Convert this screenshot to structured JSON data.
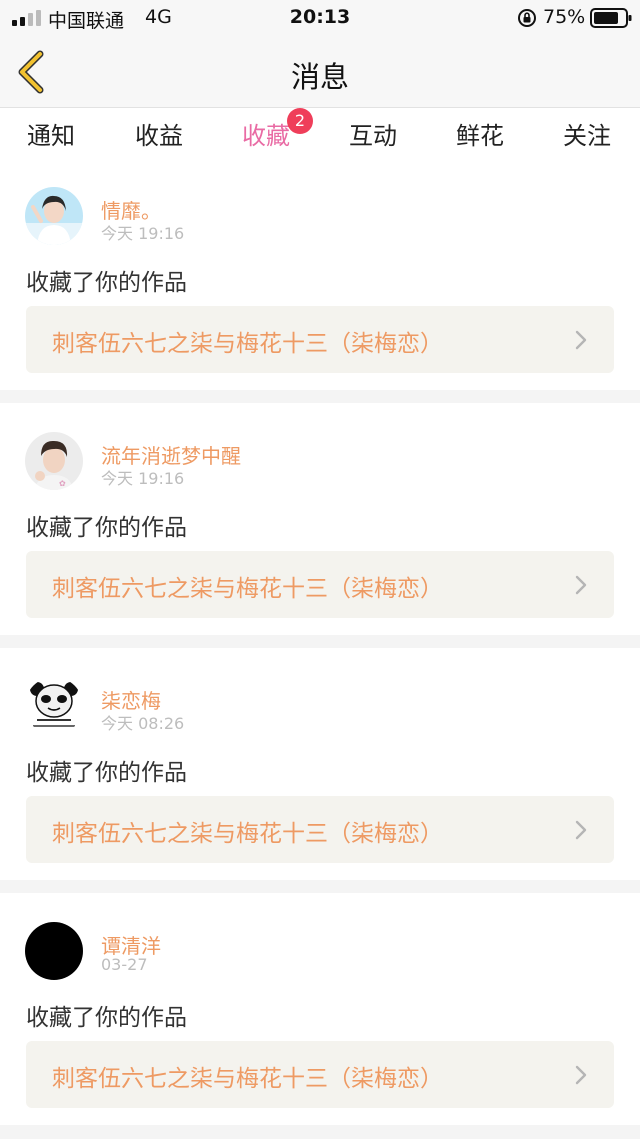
{
  "status": {
    "carrier": "中国联通",
    "network": "4G",
    "time": "20:13",
    "battery": "75%"
  },
  "nav": {
    "title": "消息"
  },
  "tabs": [
    {
      "label": "通知"
    },
    {
      "label": "收益"
    },
    {
      "label": "收藏",
      "badge": "2"
    },
    {
      "label": "互动"
    },
    {
      "label": "鲜花"
    },
    {
      "label": "关注"
    }
  ],
  "messages": [
    {
      "name": "情靡。",
      "time": "今天 19:16",
      "action": "收藏了你的作品",
      "work": "刺客伍六七之柒与梅花十三（柒梅恋）"
    },
    {
      "name": "流年消逝梦中醒",
      "time": "今天 19:16",
      "action": "收藏了你的作品",
      "work": "刺客伍六七之柒与梅花十三（柒梅恋）"
    },
    {
      "name": "柒恋梅",
      "time": "今天 08:26",
      "action": "收藏了你的作品",
      "work": "刺客伍六七之柒与梅花十三（柒梅恋）"
    },
    {
      "name": "谭清洋",
      "time": "03-27",
      "action": "收藏了你的作品",
      "work": "刺客伍六七之柒与梅花十三（柒梅恋）"
    }
  ],
  "colors": {
    "accent": "#e96ba4",
    "name": "#ee9a63",
    "badge": "#ef3e5a",
    "back_arrow": "#e8b830"
  }
}
